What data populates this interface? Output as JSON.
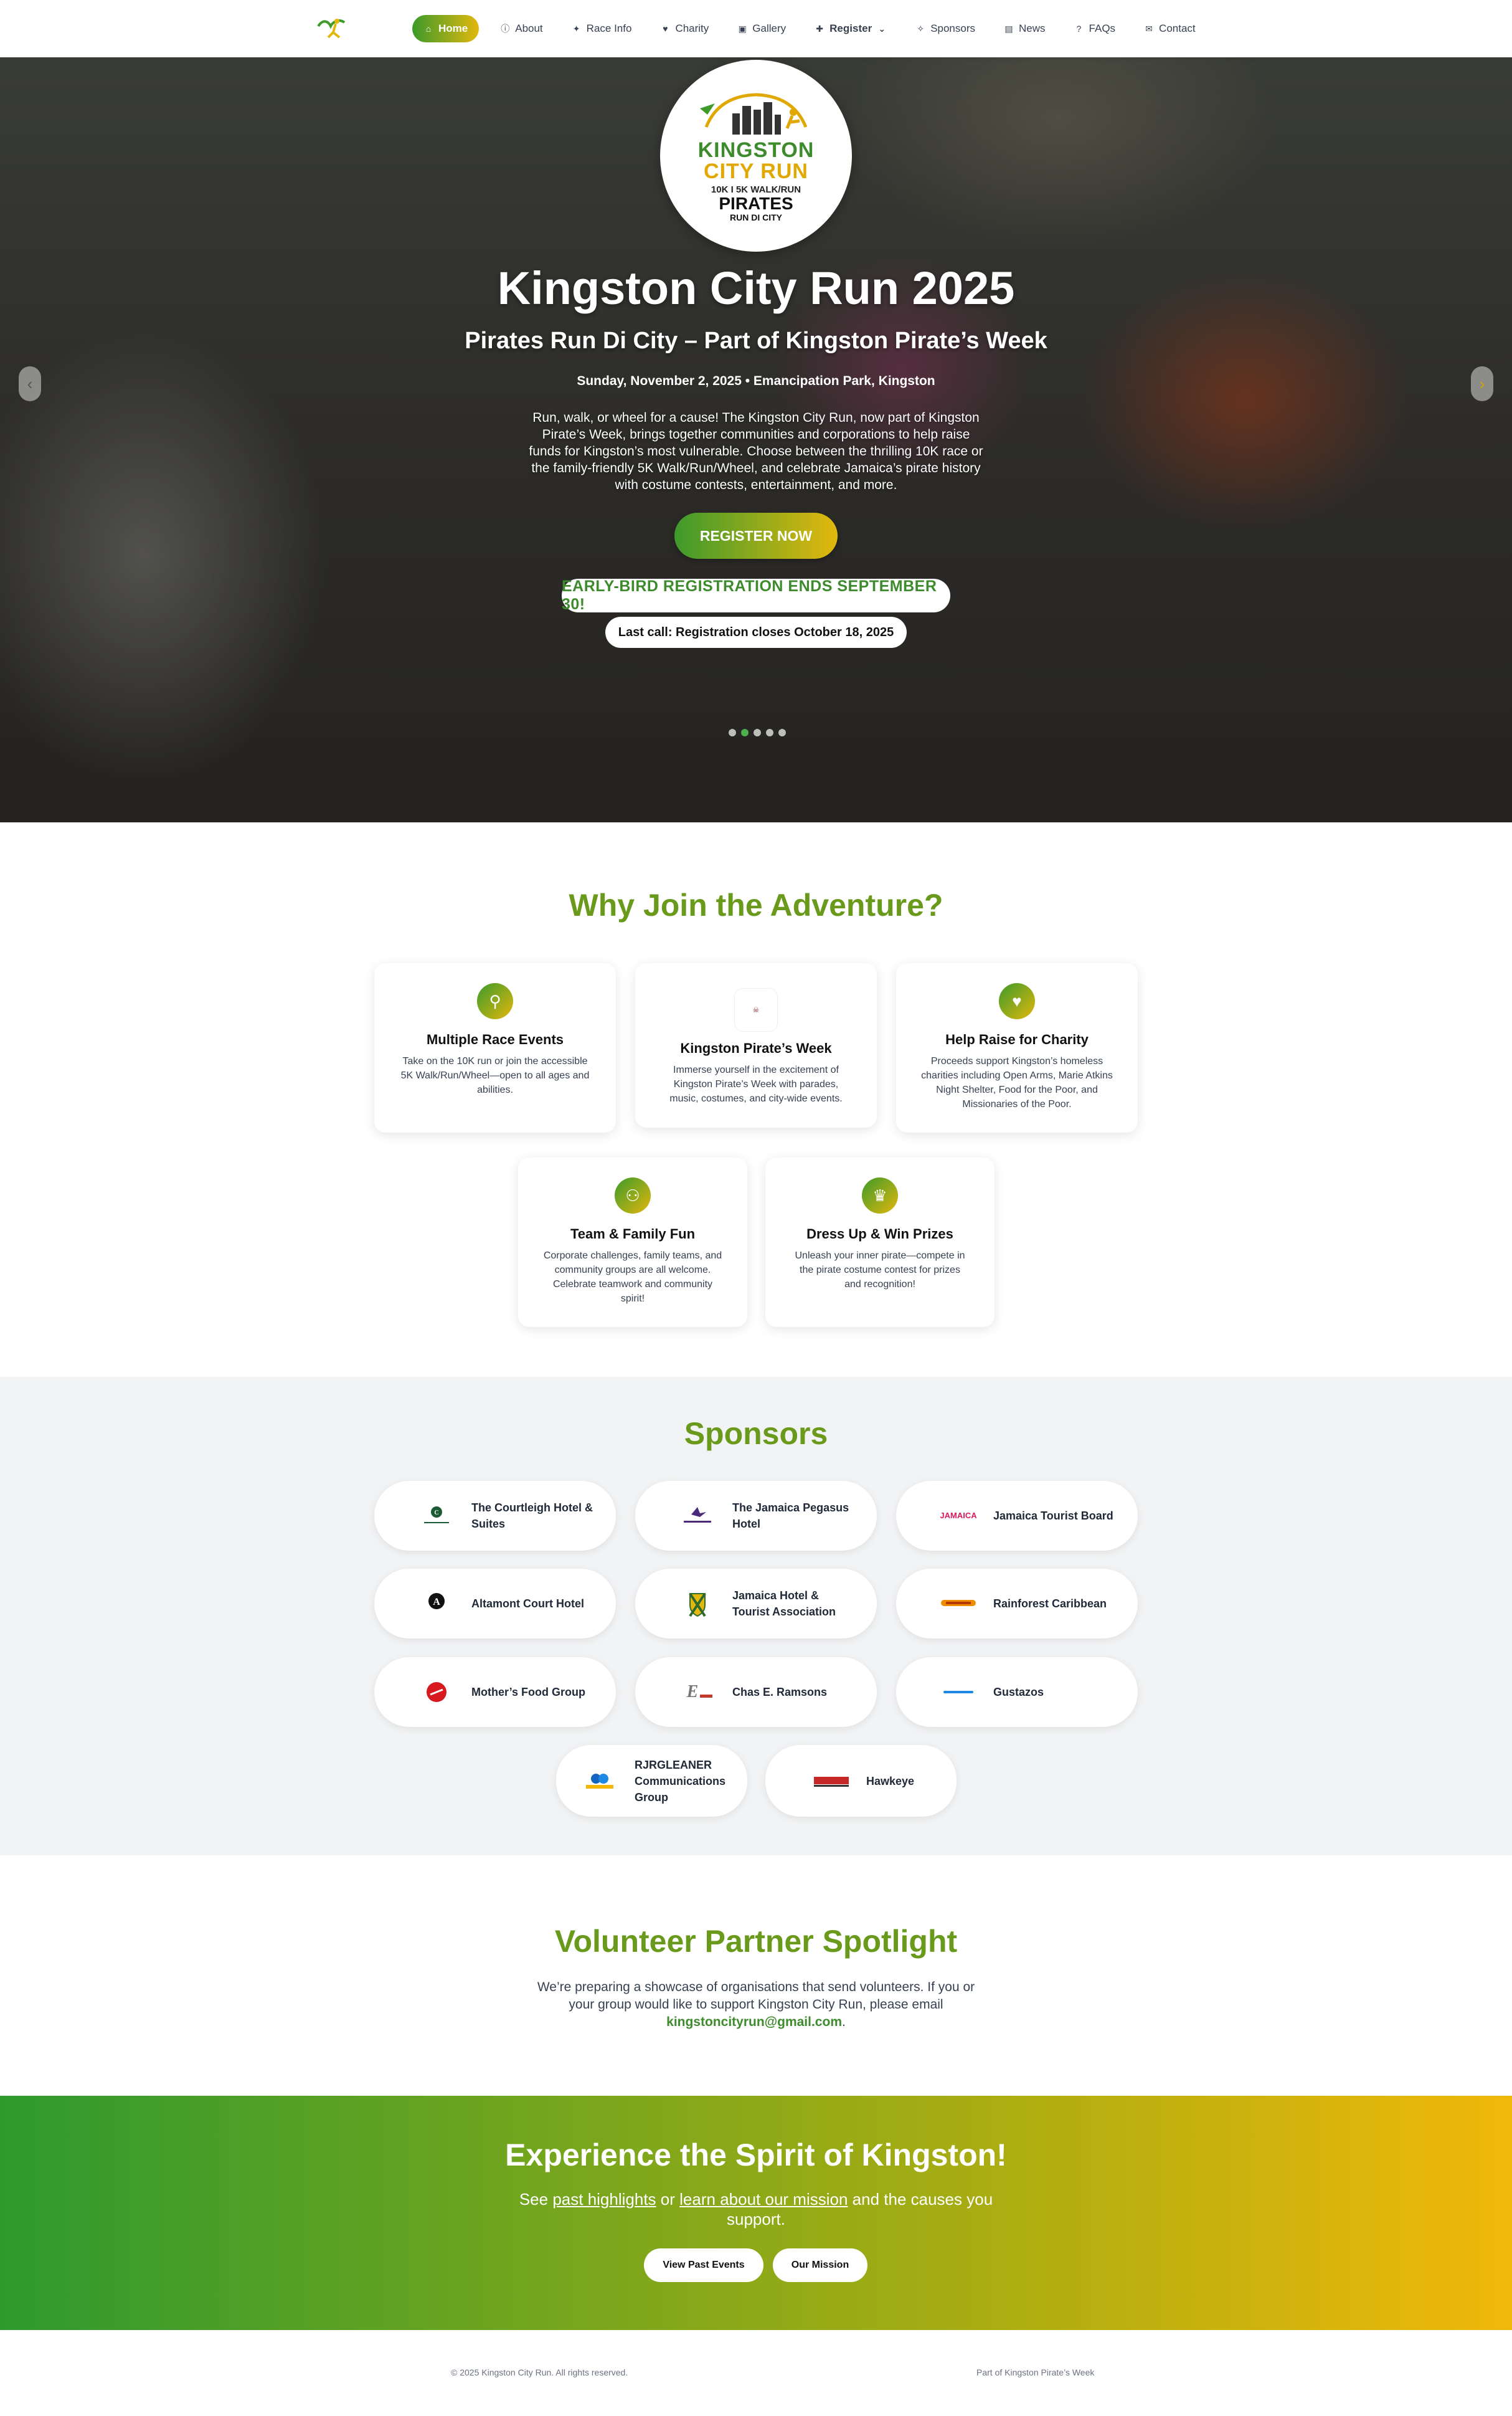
{
  "nav": {
    "items": [
      {
        "label": "Home",
        "icon": "home-icon",
        "glyph": "⌂"
      },
      {
        "label": "About",
        "icon": "info-icon",
        "glyph": "ⓘ"
      },
      {
        "label": "Race Info",
        "icon": "runner-icon",
        "glyph": "✦"
      },
      {
        "label": "Charity",
        "icon": "hand-heart-icon",
        "glyph": "♥"
      },
      {
        "label": "Gallery",
        "icon": "gallery-icon",
        "glyph": "▣"
      },
      {
        "label": "Register",
        "icon": "user-plus-icon",
        "glyph": "✚"
      },
      {
        "label": "Sponsors",
        "icon": "handshake-icon",
        "glyph": "✧"
      },
      {
        "label": "News",
        "icon": "newspaper-icon",
        "glyph": "▤"
      },
      {
        "label": "FAQs",
        "icon": "question-icon",
        "glyph": "?"
      },
      {
        "label": "Contact",
        "icon": "envelope-icon",
        "glyph": "✉"
      }
    ]
  },
  "hero": {
    "badge": {
      "line1": "KINGSTON",
      "line2": "CITY RUN",
      "line3": "10K I 5K WALK/RUN",
      "line4": "PIRATES",
      "line5": "RUN DI CITY"
    },
    "title": "Kingston City Run 2025",
    "subtitle": "Pirates Run Di City – Part of Kingston Pirate’s Week",
    "date": "Sunday, November 2, 2025 • Emancipation Park, Kingston",
    "description": "Run, walk, or wheel for a cause! The Kingston City Run, now part of Kingston Pirate’s Week, brings together communities and corporations to help raise funds for Kingston’s most vulnerable. Choose between the thrilling 10K race or the family-friendly 5K Walk/Run/Wheel, and celebrate Jamaica’s pirate history with costume contests, entertainment, and more.",
    "cta": "REGISTER NOW",
    "early_bird": "EARLY-BIRD REGISTRATION ENDS SEPTEMBER 30!",
    "last_call": "Last call: Registration closes October 18, 2025",
    "slides": 5,
    "active_slide": 2
  },
  "why": {
    "title": "Why Join the Adventure?",
    "cards": [
      {
        "title": "Multiple Race Events",
        "text": "Take on the 10K run or join the accessible 5K Walk/Run/Wheel—open to all ages and abilities.",
        "icon": "location-pin-icon"
      },
      {
        "title": "Kingston Pirate’s Week",
        "text": "Immerse yourself in the excitement of Kingston Pirate’s Week with parades, music, costumes, and city-wide events.",
        "icon": "pirates-week-logo"
      },
      {
        "title": "Help Raise for Charity",
        "text": "Proceeds support Kingston’s homeless charities including Open Arms, Marie Atkins Night Shelter, Food for the Poor, and Missionaries of the Poor.",
        "icon": "heart-icon"
      },
      {
        "title": "Team & Family Fun",
        "text": "Corporate challenges, family teams, and community groups are all welcome. Celebrate teamwork and community spirit!",
        "icon": "group-icon"
      },
      {
        "title": "Dress Up & Win Prizes",
        "text": "Unleash your inner pirate—compete in the pirate costume contest for prizes and recognition!",
        "icon": "trophy-icon"
      }
    ]
  },
  "sponsors": {
    "title": "Sponsors",
    "items": [
      "The Courtleigh Hotel & Suites",
      "The Jamaica Pegasus Hotel",
      "Jamaica Tourist Board",
      "Altamont Court Hotel",
      "Jamaica Hotel & Tourist Association",
      "Rainforest Caribbean",
      "Mother’s Food Group",
      "Chas E. Ramsons",
      "Gustazos",
      "RJRGLEANER Communications Group",
      "Hawkeye"
    ]
  },
  "volunteer": {
    "title": "Volunteer Partner Spotlight",
    "text": "We’re preparing a showcase of organisations that send volunteers. If you or your group would like to support Kingston City Run, please email",
    "email": "kingstoncityrun@gmail.com",
    "period": "."
  },
  "band": {
    "title": "Experience the Spirit of Kingston!",
    "text_pre": "See",
    "link1": "past highlights",
    "text_mid": "or",
    "link2": "learn about our mission",
    "text_post": "and the causes you support.",
    "btn1": "View Past Events",
    "btn2": "Our Mission"
  },
  "footer": {
    "copyright": "© 2025 Kingston City Run. All rights reserved.",
    "right": "Part of Kingston Pirate’s Week"
  },
  "colors": {
    "green": "#3d8b2c",
    "gold": "#e2b80d",
    "title_green": "#6a9a1c"
  }
}
